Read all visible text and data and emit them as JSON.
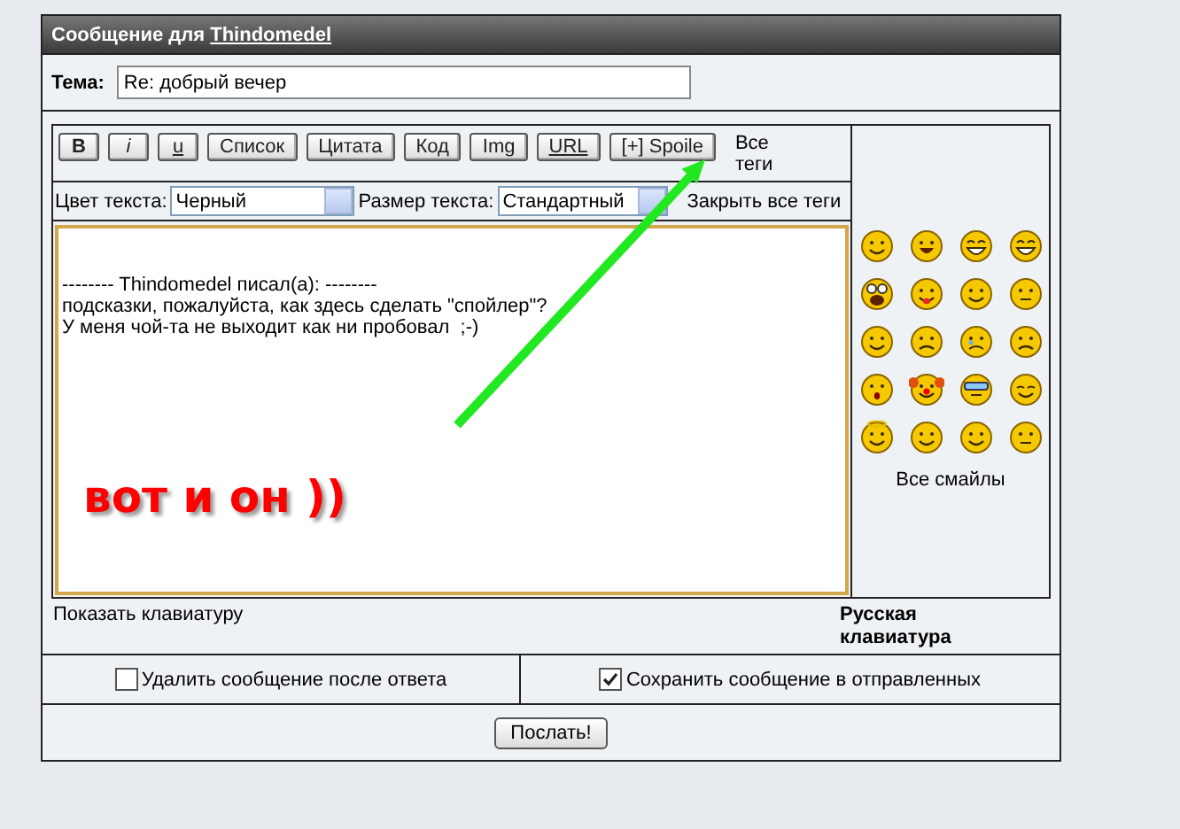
{
  "header": {
    "prefix": "Сообщение для",
    "user": "Thindomedel"
  },
  "subject": {
    "label": "Тема:",
    "value": "Re: добрый вечер"
  },
  "toolbar": [
    {
      "label": "B",
      "kind": "bold"
    },
    {
      "label": "i",
      "kind": "italic"
    },
    {
      "label": "u",
      "kind": "underline"
    },
    {
      "label": "Список",
      "kind": "plain"
    },
    {
      "label": "Цитата",
      "kind": "plain"
    },
    {
      "label": "Код",
      "kind": "plain"
    },
    {
      "label": "Img",
      "kind": "plain"
    },
    {
      "label": "URL",
      "kind": "underline"
    },
    {
      "label": "[+] Spoile",
      "kind": "plain"
    }
  ],
  "all_tags": "Все теги",
  "text_color": {
    "label": "Цвет текста:",
    "value": "Черный"
  },
  "text_size": {
    "label": "Размер текста:",
    "value": "Стандартный"
  },
  "close_tags": "Закрыть все теги",
  "message": "\n\n-------- Thindomedel писал(а): --------\nподсказки, пожалуйста, как здесь сделать \"спойлер\"?\nУ меня чой-та не выходит как ни пробовал  ;-)",
  "all_smileys": "Все смайлы",
  "show_keyboard": "Показать клавиатуру",
  "keyboard_title": "Русская клавиатура",
  "options": [
    {
      "label": "Удалить сообщение после ответа",
      "checked": false
    },
    {
      "label": "Сохранить сообщение в отправленных",
      "checked": true
    }
  ],
  "submit": "Послать!",
  "annotation": "вот и он ))"
}
